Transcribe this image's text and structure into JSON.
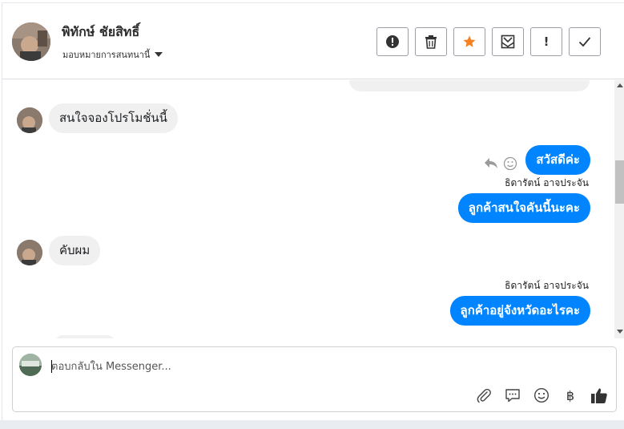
{
  "header": {
    "contact_name": "พิทักษ์ ชัยสิทธิ์",
    "assign_label": "มอบหมายการสนทนานี้"
  },
  "actions": [
    {
      "name": "mark-spam-button",
      "icon": "alert-circle-icon"
    },
    {
      "name": "delete-button",
      "icon": "trash-icon"
    },
    {
      "name": "star-button",
      "icon": "star-icon",
      "color": "#f5821f"
    },
    {
      "name": "mark-unread-button",
      "icon": "envelope-open-icon"
    },
    {
      "name": "important-button",
      "icon": "exclamation-icon",
      "label": "!"
    },
    {
      "name": "done-button",
      "icon": "check-icon"
    }
  ],
  "messages": [
    {
      "direction": "in",
      "text": "สนใจจองโปรโมชั่นนี้"
    },
    {
      "direction": "out",
      "text": "สวัสดีค่ะ"
    },
    {
      "direction": "out",
      "sender": "ธิดารัตน์ อาจประจัน",
      "text": "ลูกค้าสนใจคันนี้นะคะ"
    },
    {
      "direction": "in",
      "text": "คับผม"
    },
    {
      "direction": "out",
      "sender": "ธิดารัตน์ อาจประจัน",
      "text": "ลูกค้าอยู่จังหวัดอะไรคะ"
    }
  ],
  "composer": {
    "placeholder": "ตอบกลับใน Messenger...",
    "value": "",
    "tools": [
      "paperclip-icon",
      "speech-bubble-icon",
      "smiley-icon",
      "baht-icon",
      "thumbs-up-icon"
    ],
    "baht_glyph": "฿"
  },
  "colors": {
    "accent": "#0084ff",
    "star": "#f5821f",
    "incoming_bubble": "#f0f0f0"
  }
}
